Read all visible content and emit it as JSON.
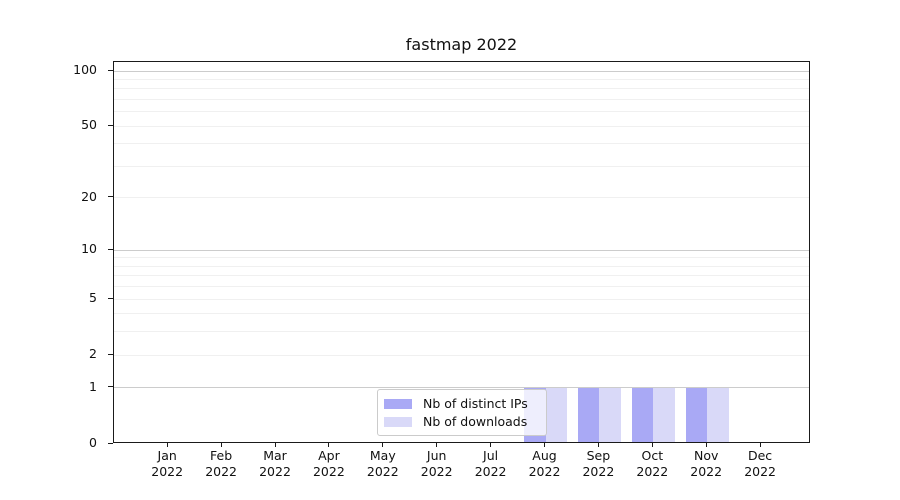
{
  "title": "fastmap 2022",
  "legend": {
    "items": [
      {
        "label": "Nb of distinct IPs",
        "color": "#a9a9f5"
      },
      {
        "label": "Nb of downloads",
        "color": "#d9d9f8"
      }
    ]
  },
  "chart_data": {
    "type": "bar",
    "title": "fastmap 2022",
    "categories": [
      "Jan 2022",
      "Feb 2022",
      "Mar 2022",
      "Apr 2022",
      "May 2022",
      "Jun 2022",
      "Jul 2022",
      "Aug 2022",
      "Sep 2022",
      "Oct 2022",
      "Nov 2022",
      "Dec 2022"
    ],
    "series": [
      {
        "name": "Nb of distinct IPs",
        "color": "#a9a9f5",
        "values": [
          0,
          0,
          0,
          0,
          0,
          0,
          0,
          1,
          1,
          1,
          1,
          0
        ]
      },
      {
        "name": "Nb of downloads",
        "color": "#d9d9f8",
        "values": [
          0,
          0,
          0,
          0,
          0,
          0,
          0,
          1,
          1,
          1,
          1,
          0
        ]
      }
    ],
    "xlabel": "",
    "ylabel": "",
    "yscale": "log10(value+1)",
    "ylim": [
      0,
      112
    ],
    "y_tick_values": [
      0,
      1,
      2,
      5,
      10,
      20,
      50,
      100
    ],
    "y_major_gridlines": [
      1,
      10,
      100
    ],
    "y_minor_gridlines": [
      2,
      3,
      4,
      5,
      6,
      7,
      8,
      9,
      20,
      30,
      40,
      50,
      60,
      70,
      80,
      90
    ],
    "grid": true,
    "legend_position": "lower center"
  }
}
